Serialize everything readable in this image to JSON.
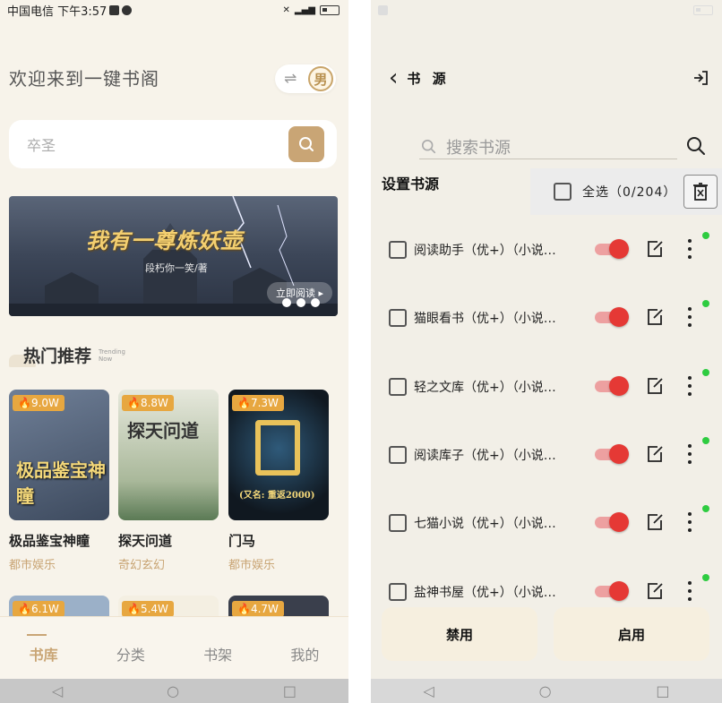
{
  "left": {
    "status": {
      "carrier": "中国电信 下午3:57"
    },
    "welcome": "欢迎来到一键书阁",
    "gender_toggle": {
      "swap_icon": "⇌",
      "label": "男"
    },
    "search": {
      "placeholder": "卒圣"
    },
    "banner": {
      "title": "我有一尊炼妖壶",
      "author": "段朽你一笑/著",
      "read_button": "立即阅读 ▸"
    },
    "section": {
      "title": "热门推荐",
      "subtitle_line1": "Trending",
      "subtitle_line2": "Now"
    },
    "books_row1": [
      {
        "name": "极品鉴宝神瞳",
        "genre": "都市娱乐",
        "heat": "9.0W",
        "cover_text": "极品鉴宝神瞳",
        "cover_color": "#5e6f87"
      },
      {
        "name": "探天问道",
        "genre": "奇幻玄幻",
        "heat": "8.8W",
        "cover_text": "探天问道",
        "cover_color": "#d9dccc"
      },
      {
        "name": "门马",
        "genre": "都市娱乐",
        "heat": "7.3W",
        "cover_text": "(又名: 重返2000)",
        "cover_color": "#1b2b3c"
      }
    ],
    "books_row2": [
      {
        "heat": "6.1W"
      },
      {
        "heat": "5.4W"
      },
      {
        "heat": "4.7W"
      }
    ],
    "nav": [
      {
        "label": "书库"
      },
      {
        "label": "分类"
      },
      {
        "label": "书架"
      },
      {
        "label": "我的"
      }
    ]
  },
  "right": {
    "title": "书 源",
    "search": {
      "placeholder": "搜索书源"
    },
    "set_source": "设置书源",
    "select_all": "全选（0/204）",
    "sources": [
      {
        "name": "阅读助手（优+）（小说…"
      },
      {
        "name": "猫眼看书（优+）（小说…"
      },
      {
        "name": "轻之文库（优+）（小说…"
      },
      {
        "name": "阅读库子（优+）（小说…"
      },
      {
        "name": "七猫小说（优+）（小说…"
      },
      {
        "name": "盐神书屋（优+）（小说…"
      }
    ],
    "disable_button": "禁用",
    "enable_button": "启用"
  },
  "colors": {
    "accent_gold": "#c9a575",
    "switch_on": "#e53935",
    "status_ok": "#2ecc40",
    "heat_badge": "#e7a740"
  }
}
